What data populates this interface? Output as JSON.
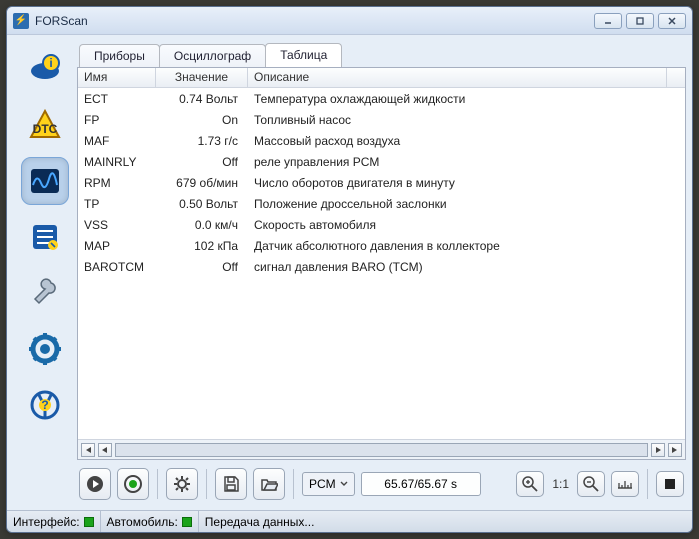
{
  "window": {
    "title": "FORScan"
  },
  "tabs": [
    {
      "label": "Приборы",
      "active": false
    },
    {
      "label": "Осциллограф",
      "active": false
    },
    {
      "label": "Таблица",
      "active": true
    }
  ],
  "table": {
    "headers": {
      "name": "Имя",
      "value": "Значение",
      "desc": "Описание"
    },
    "rows": [
      {
        "name": "ECT",
        "value": "0.74 Вольт",
        "desc": "Температура охлаждающей жидкости"
      },
      {
        "name": "FP",
        "value": "On",
        "desc": "Топливный насос"
      },
      {
        "name": "MAF",
        "value": "1.73 г/с",
        "desc": "Массовый расход воздуха"
      },
      {
        "name": "MAINRLY",
        "value": "Off",
        "desc": "реле управления PCM"
      },
      {
        "name": "RPM",
        "value": "679 об/мин",
        "desc": "Число оборотов двигателя в минуту"
      },
      {
        "name": "TP",
        "value": "0.50 Вольт",
        "desc": "Положение дроссельной заслонки"
      },
      {
        "name": "VSS",
        "value": "0.0 км/ч",
        "desc": "Скорость автомобиля"
      },
      {
        "name": "MAP",
        "value": "102 кПа",
        "desc": "Датчик абсолютного давления в коллекторе"
      },
      {
        "name": "BAROTCM",
        "value": "Off",
        "desc": "сигнал давления BARO (TCM)"
      }
    ]
  },
  "toolbar": {
    "module": "PCM",
    "time": "65.67/65.67 s",
    "zoom_ratio": "1:1"
  },
  "status": {
    "interface_label": "Интерфейс:",
    "vehicle_label": "Автомобиль:",
    "data_label": "Передача данных..."
  }
}
